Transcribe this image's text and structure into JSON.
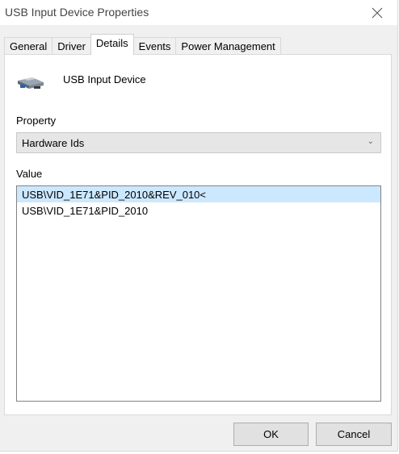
{
  "window": {
    "title": "USB Input Device Properties",
    "close_icon": "close-icon"
  },
  "tabs": [
    {
      "label": "General"
    },
    {
      "label": "Driver"
    },
    {
      "label": "Details",
      "active": true
    },
    {
      "label": "Events"
    },
    {
      "label": "Power Management"
    }
  ],
  "device": {
    "icon": "usb-device-icon",
    "name": "USB Input Device"
  },
  "property": {
    "label": "Property",
    "selected": "Hardware Ids"
  },
  "value": {
    "label": "Value",
    "items": [
      {
        "text": "USB\\VID_1E71&PID_2010&REV_010<",
        "selected": true
      },
      {
        "text": "USB\\VID_1E71&PID_2010",
        "selected": false
      }
    ]
  },
  "buttons": {
    "ok": "OK",
    "cancel": "Cancel"
  },
  "colors": {
    "selection": "#cce8ff",
    "dialog_bg": "#f0f0f0"
  }
}
